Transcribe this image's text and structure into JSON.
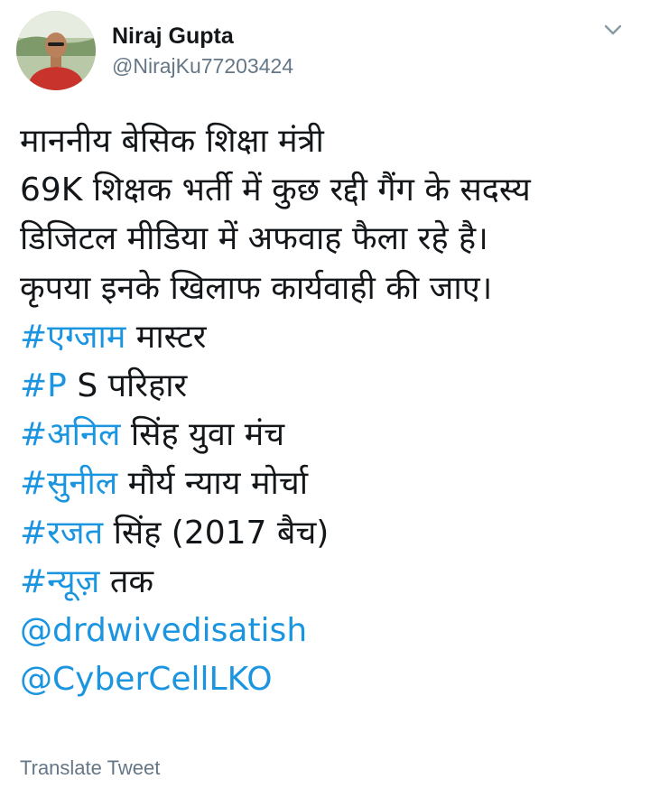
{
  "author": {
    "display_name": "Niraj Gupta",
    "handle": "@NirajKu77203424"
  },
  "menu": {
    "icon": "chevron-down-icon"
  },
  "tweet": {
    "line1": "माननीय बेसिक शिक्षा मंत्री",
    "line2": "69K शिक्षक भर्ती में कुछ रद्दी गैंग के सदस्य",
    "line3": "डिजिटल मीडिया में अफवाह फैला रहे है।",
    "line4": "कृपया इनके खिलाफ कार्यवाही की जाए।",
    "hashtags": [
      {
        "tag": "#एग्जाम",
        "rest": " मास्टर"
      },
      {
        "tag": "#P",
        "rest": " S परिहार"
      },
      {
        "tag": "#अनिल",
        "rest": " सिंह युवा मंच"
      },
      {
        "tag": "#सुनील",
        "rest": " मौर्य न्याय मोर्चा"
      },
      {
        "tag": "#रजत",
        "rest": " सिंह (2017 बैच)"
      },
      {
        "tag": "#न्यूज़",
        "rest": " तक"
      }
    ],
    "mentions": [
      "@drdwivedisatish",
      "@CyberCellLKO"
    ]
  },
  "translate_label": "Translate Tweet",
  "colors": {
    "link": "#1b95e0",
    "secondary_text": "#657786",
    "primary_text": "#14171a"
  }
}
